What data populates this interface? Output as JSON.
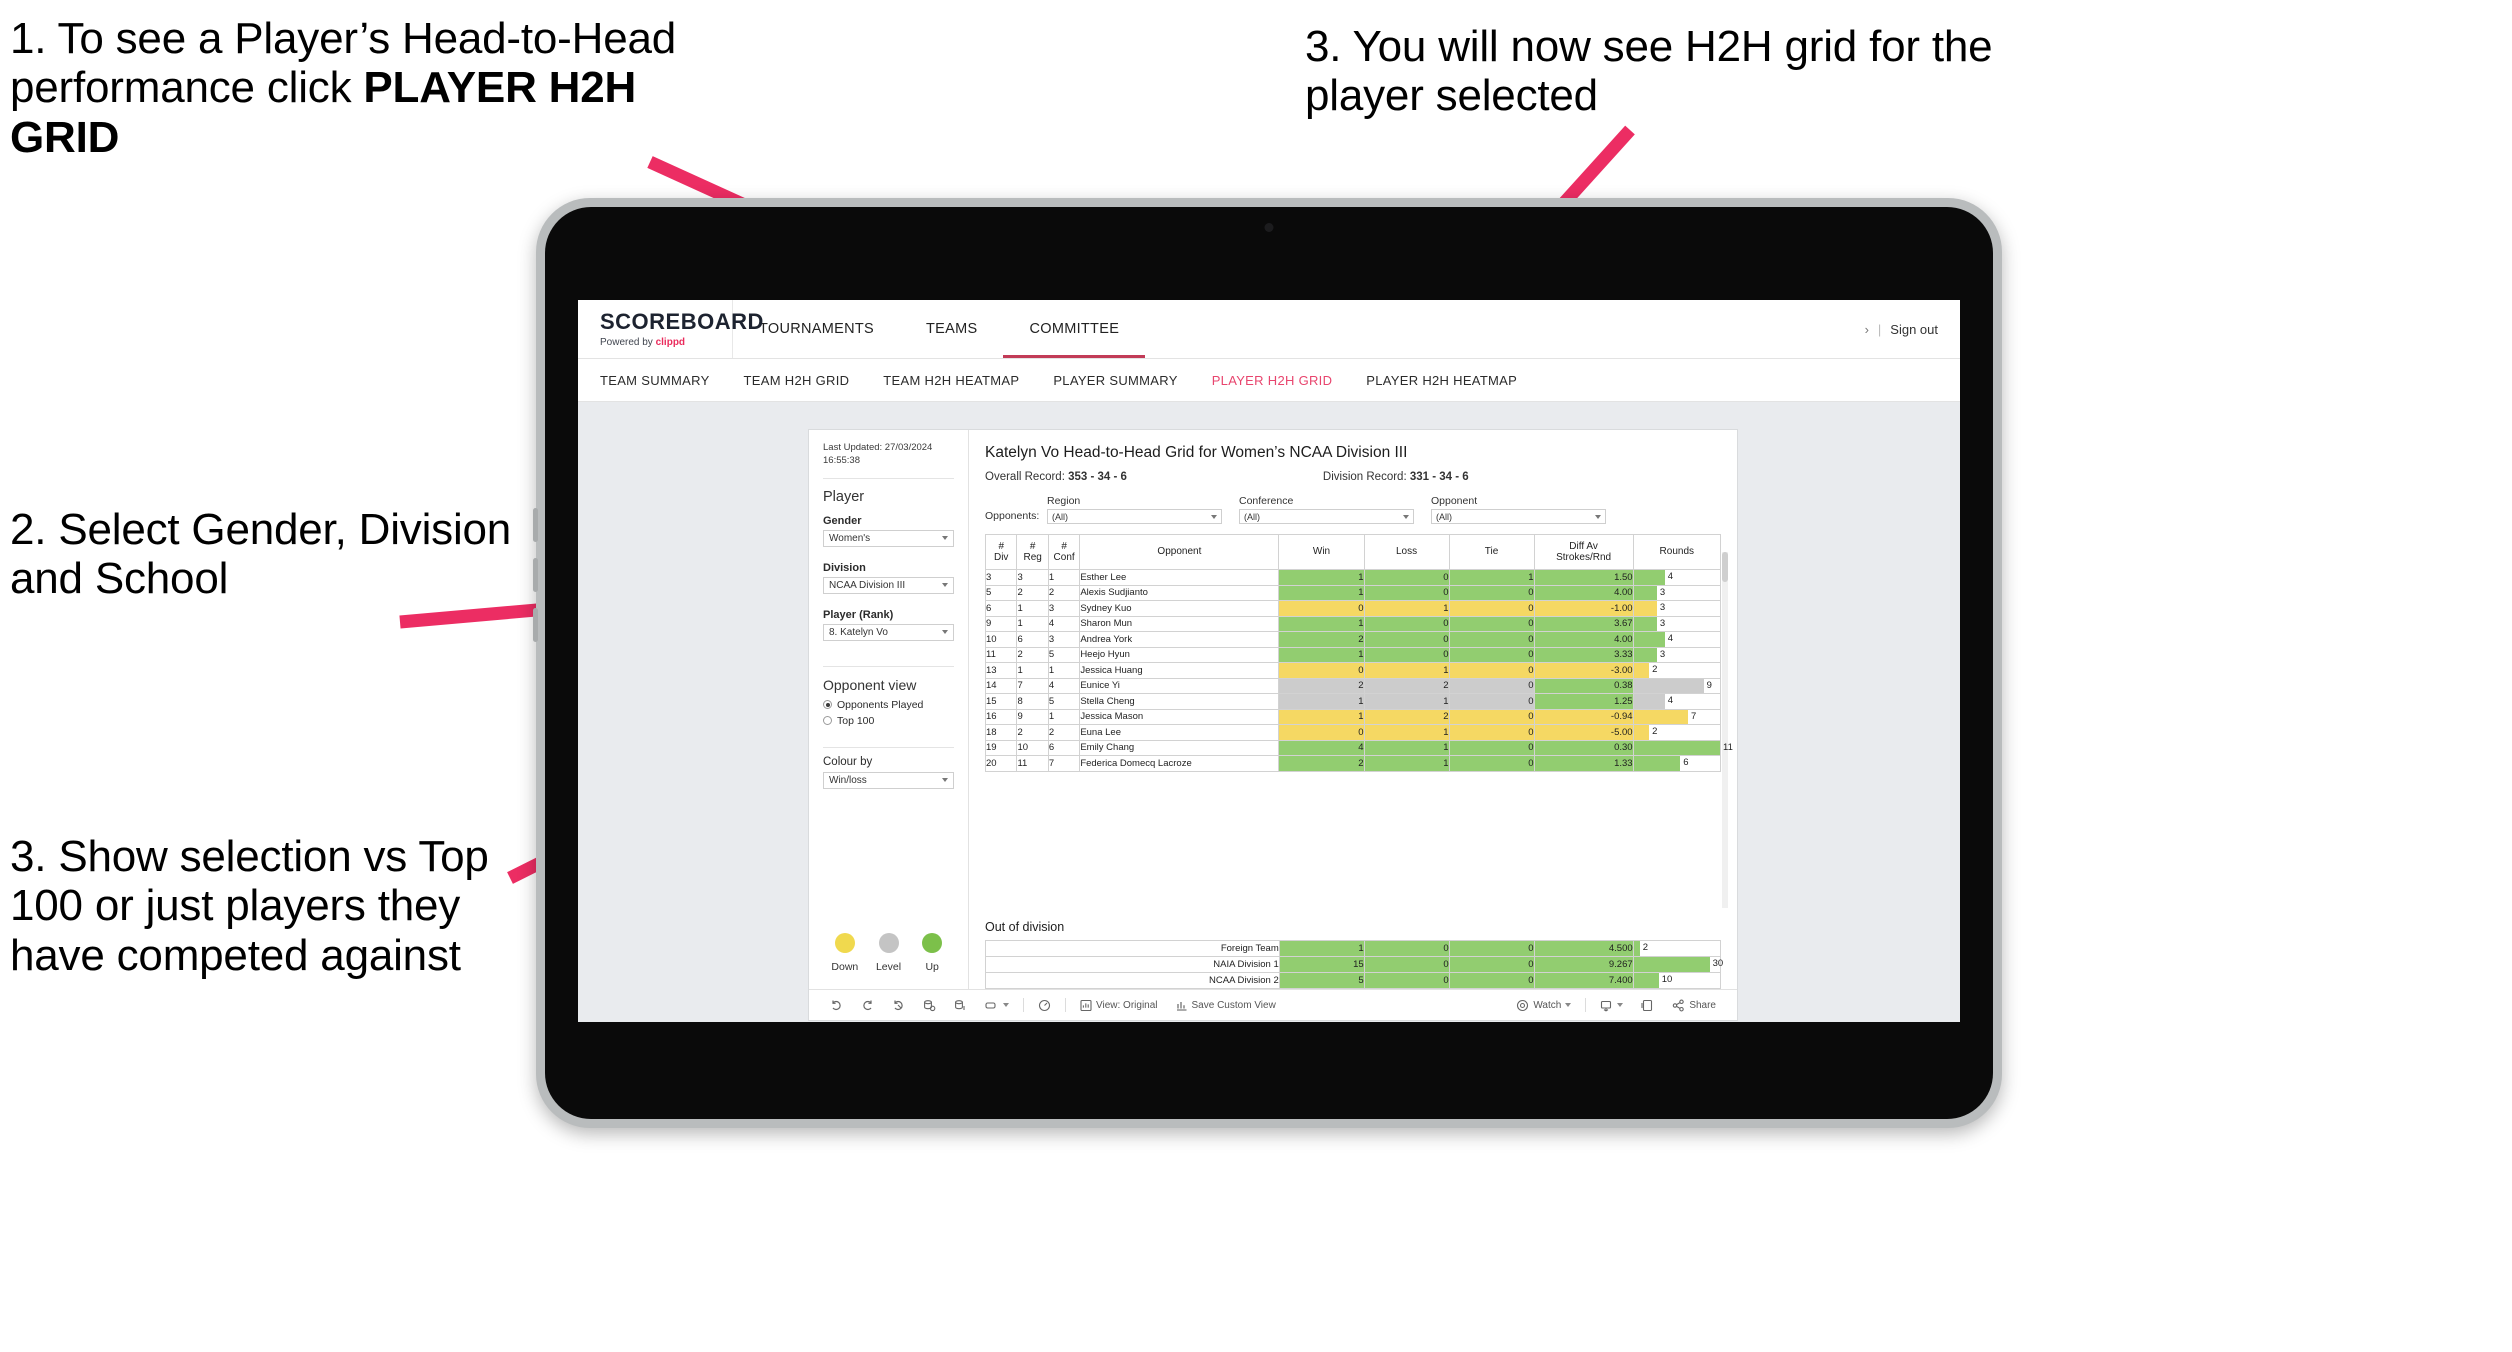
{
  "annotations": [
    {
      "id": "a1",
      "text_pre": "1. To see a Player’s Head-to-Head performance click ",
      "text_bold": "PLAYER H2H GRID"
    },
    {
      "id": "a2",
      "text": "3. You will now see H2H grid for the player selected"
    },
    {
      "id": "a3",
      "text": "2. Select Gender, Division and School"
    },
    {
      "id": "a4",
      "text": "3. Show selection vs Top 100 or just players they have competed against"
    }
  ],
  "colors": {
    "accent_pink": "#e8456e",
    "arrow_pink": "#ec2d63",
    "brand_red": "#ea2b5c",
    "win_green": "#92cd70",
    "loss_yellow": "#f5d863",
    "tie_gray": "#cccccc",
    "bezel": "#b9bcbd"
  },
  "app": {
    "logo": {
      "main": "SCOREBOARD",
      "sub_pre": "Powered by ",
      "sub_brand": "clippd"
    },
    "topnav": [
      {
        "label": "TOURNAMENTS",
        "active": false
      },
      {
        "label": "TEAMS",
        "active": false
      },
      {
        "label": "COMMITTEE",
        "active": true
      }
    ],
    "top_right": {
      "chevron": "›",
      "divider": "|",
      "signout": "Sign out"
    },
    "subnav": [
      {
        "label": "TEAM SUMMARY",
        "active": false
      },
      {
        "label": "TEAM H2H GRID",
        "active": false
      },
      {
        "label": "TEAM H2H HEATMAP",
        "active": false
      },
      {
        "label": "PLAYER SUMMARY",
        "active": false
      },
      {
        "label": "PLAYER H2H GRID",
        "active": true
      },
      {
        "label": "PLAYER H2H HEATMAP",
        "active": false
      }
    ]
  },
  "filters": {
    "last_updated": "Last Updated: 27/03/2024 16:55:38",
    "section_title": "Player",
    "gender": {
      "label": "Gender",
      "value": "Women's"
    },
    "division": {
      "label": "Division",
      "value": "NCAA Division III"
    },
    "player": {
      "label": "Player (Rank)",
      "value": "8. Katelyn Vo"
    },
    "opponent_view": {
      "title": "Opponent view",
      "options": [
        {
          "label": "Opponents Played",
          "selected": true
        },
        {
          "label": "Top 100",
          "selected": false
        }
      ]
    },
    "colour_by": {
      "label": "Colour by",
      "value": "Win/loss"
    },
    "legend": [
      {
        "label": "Down",
        "color": "#f0d94e"
      },
      {
        "label": "Level",
        "color": "#c4c4c4"
      },
      {
        "label": "Up",
        "color": "#7cc04a"
      }
    ]
  },
  "viz": {
    "title": "Katelyn Vo Head-to-Head Grid for Women’s NCAA Division III",
    "overall_label": "Overall Record: ",
    "overall_value": "353 - 34 - 6",
    "division_label": "Division Record: ",
    "division_value": "331 - 34 - 6",
    "opponents_label": "Opponents:",
    "opp_filters": [
      {
        "title": "Region",
        "value": "(All)"
      },
      {
        "title": "Conference",
        "value": "(All)"
      },
      {
        "title": "Opponent",
        "value": "(All)"
      }
    ],
    "columns": [
      "#\nDiv",
      "#\nReg",
      "#\nConf",
      "Opponent",
      "Win",
      "Loss",
      "Tie",
      "Diff Av\nStrokes/Rnd",
      "Rounds"
    ],
    "column_labels": {
      "div_l1": "#",
      "div_l2": "Div",
      "reg_l1": "#",
      "reg_l2": "Reg",
      "conf_l1": "#",
      "conf_l2": "Conf",
      "opponent": "Opponent",
      "win": "Win",
      "loss": "Loss",
      "tie": "Tie",
      "diff_l1": "Diff Av",
      "diff_l2": "Strokes/Rnd",
      "rounds": "Rounds"
    },
    "rows": [
      {
        "div": "3",
        "reg": "3",
        "conf": "1",
        "opponent": "Esther Lee",
        "win": "1",
        "loss": "0",
        "tie": "1",
        "diff": "1.50",
        "rounds": "4",
        "state": "up",
        "bar_pct": 36
      },
      {
        "div": "5",
        "reg": "2",
        "conf": "2",
        "opponent": "Alexis Sudjianto",
        "win": "1",
        "loss": "0",
        "tie": "0",
        "diff": "4.00",
        "rounds": "3",
        "state": "up",
        "bar_pct": 27
      },
      {
        "div": "6",
        "reg": "1",
        "conf": "3",
        "opponent": "Sydney Kuo",
        "win": "0",
        "loss": "1",
        "tie": "0",
        "diff": "-1.00",
        "rounds": "3",
        "state": "down",
        "bar_pct": 27
      },
      {
        "div": "9",
        "reg": "1",
        "conf": "4",
        "opponent": "Sharon Mun",
        "win": "1",
        "loss": "0",
        "tie": "0",
        "diff": "3.67",
        "rounds": "3",
        "state": "up",
        "bar_pct": 27
      },
      {
        "div": "10",
        "reg": "6",
        "conf": "3",
        "opponent": "Andrea York",
        "win": "2",
        "loss": "0",
        "tie": "0",
        "diff": "4.00",
        "rounds": "4",
        "state": "up",
        "bar_pct": 36
      },
      {
        "div": "11",
        "reg": "2",
        "conf": "5",
        "opponent": "Heejo Hyun",
        "win": "1",
        "loss": "0",
        "tie": "0",
        "diff": "3.33",
        "rounds": "3",
        "state": "up",
        "bar_pct": 27
      },
      {
        "div": "13",
        "reg": "1",
        "conf": "1",
        "opponent": "Jessica Huang",
        "win": "0",
        "loss": "1",
        "tie": "0",
        "diff": "-3.00",
        "rounds": "2",
        "state": "down",
        "bar_pct": 18
      },
      {
        "div": "14",
        "reg": "7",
        "conf": "4",
        "opponent": "Eunice Yi",
        "win": "2",
        "loss": "2",
        "tie": "0",
        "diff": "0.38",
        "rounds": "9",
        "state": "level",
        "bar_pct": 81,
        "diff_state": "up"
      },
      {
        "div": "15",
        "reg": "8",
        "conf": "5",
        "opponent": "Stella Cheng",
        "win": "1",
        "loss": "1",
        "tie": "0",
        "diff": "1.25",
        "rounds": "4",
        "state": "level",
        "bar_pct": 36,
        "diff_state": "up"
      },
      {
        "div": "16",
        "reg": "9",
        "conf": "1",
        "opponent": "Jessica Mason",
        "win": "1",
        "loss": "2",
        "tie": "0",
        "diff": "-0.94",
        "rounds": "7",
        "state": "down",
        "bar_pct": 63
      },
      {
        "div": "18",
        "reg": "2",
        "conf": "2",
        "opponent": "Euna Lee",
        "win": "0",
        "loss": "1",
        "tie": "0",
        "diff": "-5.00",
        "rounds": "2",
        "state": "down",
        "bar_pct": 18
      },
      {
        "div": "19",
        "reg": "10",
        "conf": "6",
        "opponent": "Emily Chang",
        "win": "4",
        "loss": "1",
        "tie": "0",
        "diff": "0.30",
        "rounds": "11",
        "state": "up",
        "bar_pct": 100
      },
      {
        "div": "20",
        "reg": "11",
        "conf": "7",
        "opponent": "Federica Domecq Lacroze",
        "win": "2",
        "loss": "1",
        "tie": "0",
        "diff": "1.33",
        "rounds": "6",
        "state": "up",
        "bar_pct": 54
      }
    ],
    "out_of_division": {
      "title": "Out of division",
      "rows": [
        {
          "name": "Foreign Team",
          "win": "1",
          "loss": "0",
          "tie": "0",
          "diff": "4.500",
          "rounds": "2",
          "state": "up",
          "bar_pct": 7
        },
        {
          "name": "NAIA Division 1",
          "win": "15",
          "loss": "0",
          "tie": "0",
          "diff": "9.267",
          "rounds": "30",
          "state": "up",
          "bar_pct": 88
        },
        {
          "name": "NCAA Division 2",
          "win": "5",
          "loss": "0",
          "tie": "0",
          "diff": "7.400",
          "rounds": "10",
          "state": "up",
          "bar_pct": 29
        }
      ]
    },
    "toolbar": {
      "view_original": "View: Original",
      "save_custom_view": "Save Custom View",
      "watch": "Watch",
      "share": "Share"
    }
  }
}
